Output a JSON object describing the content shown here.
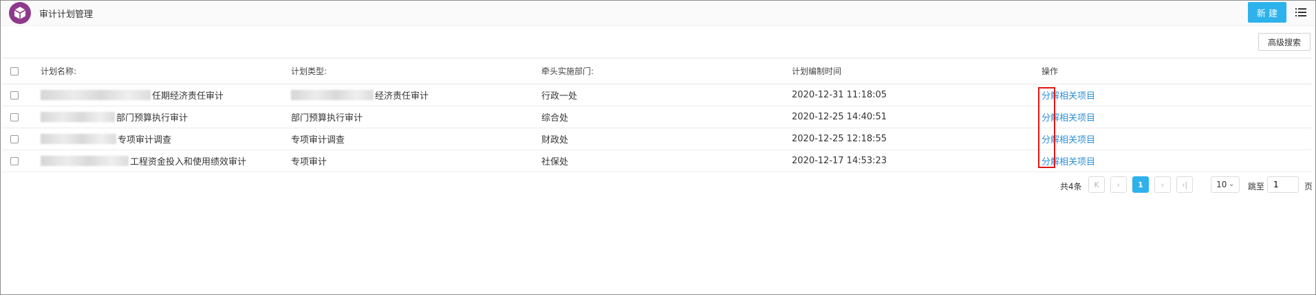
{
  "header": {
    "title": "审计计划管理",
    "new_button": "新 建",
    "brand_color": "#8e3a8c",
    "accent_color": "#2db2ec"
  },
  "toolbar": {
    "advanced_search": "高级搜索"
  },
  "table": {
    "columns": [
      "计划名称:",
      "计划类型:",
      "牵头实施部门:",
      "计划编制时间",
      "操作"
    ],
    "rows": [
      {
        "name": "任期经济责任审计",
        "type": "经济责任审计",
        "dept": "行政一处",
        "time": "2020-12-31 11:18:05"
      },
      {
        "name": "部门预算执行审计",
        "type": "部门预算执行审计",
        "dept": "综合处",
        "time": "2020-12-25 14:40:51"
      },
      {
        "name": "专项审计调查",
        "type": "专项审计调查",
        "dept": "财政处",
        "time": "2020-12-25 12:18:55"
      },
      {
        "name": "工程资金投入和使用绩效审计",
        "type": "专项审计",
        "dept": "社保处",
        "time": "2020-12-17 14:53:23"
      }
    ],
    "actions": {
      "decompose": "分解",
      "related": "相关项目"
    }
  },
  "pagination": {
    "total": "共4条",
    "first": "K",
    "prev": "‹",
    "current": "1",
    "next": "›",
    "last": "›|",
    "page_size": "10",
    "jump_label": "跳至",
    "jump_value": "1",
    "page_unit": "页"
  }
}
